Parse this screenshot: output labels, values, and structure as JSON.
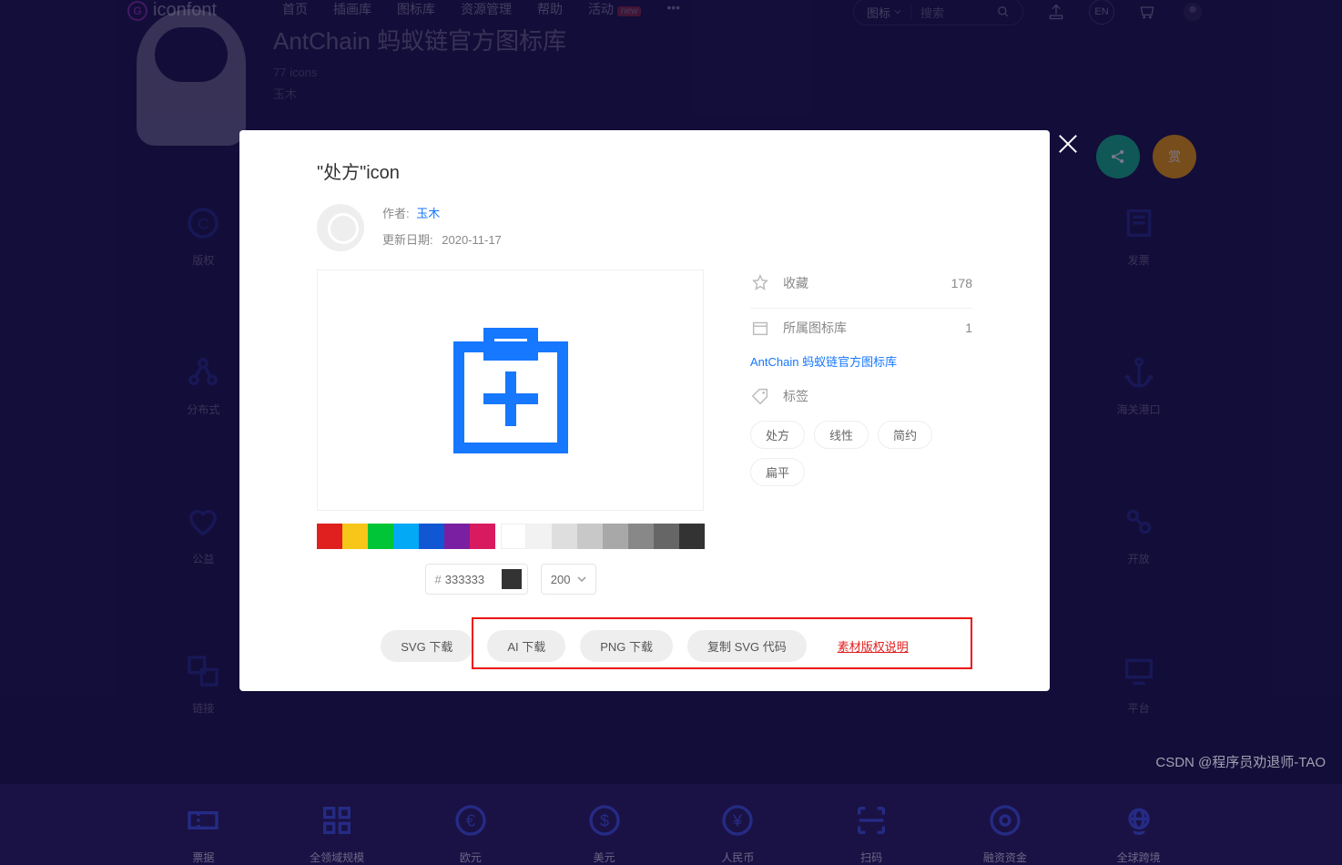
{
  "header": {
    "logo_text": "iconfont",
    "nav": [
      "首页",
      "插画库",
      "图标库",
      "资源管理",
      "帮助",
      "活动"
    ],
    "nav_badge": "new",
    "search_scope": "图标",
    "search_placeholder": "搜索"
  },
  "library": {
    "title": "AntChain 蚂蚁链官方图标库",
    "count": "77 icons",
    "owner": "玉木"
  },
  "fab": {
    "share": "分享",
    "reward": "赏"
  },
  "bg_categories": [
    {
      "label": "版权"
    },
    {
      "label": "—"
    },
    {
      "label": "—"
    },
    {
      "label": "—"
    },
    {
      "label": "—"
    },
    {
      "label": "—"
    },
    {
      "label": "—"
    },
    {
      "label": "发票"
    },
    {
      "label": "分布式"
    },
    {
      "label": "—"
    },
    {
      "label": "—"
    },
    {
      "label": "—"
    },
    {
      "label": "—"
    },
    {
      "label": "—"
    },
    {
      "label": "—"
    },
    {
      "label": "海关港口"
    },
    {
      "label": "公益"
    },
    {
      "label": "—"
    },
    {
      "label": "—"
    },
    {
      "label": "—"
    },
    {
      "label": "—"
    },
    {
      "label": "—"
    },
    {
      "label": "—"
    },
    {
      "label": "开放"
    },
    {
      "label": "链接"
    },
    {
      "label": "—"
    },
    {
      "label": "—"
    },
    {
      "label": "—"
    },
    {
      "label": "—"
    },
    {
      "label": "—"
    },
    {
      "label": "—"
    },
    {
      "label": "平台"
    },
    {
      "label": "票据"
    },
    {
      "label": "全领域规模"
    },
    {
      "label": "欧元"
    },
    {
      "label": "美元"
    },
    {
      "label": "人民币"
    },
    {
      "label": "扫码"
    },
    {
      "label": "融资资金"
    },
    {
      "label": "全球跨境"
    }
  ],
  "modal": {
    "title": "\"处方\"icon",
    "author_label": "作者:",
    "author_name": "玉木",
    "update_label": "更新日期:",
    "update_date": "2020-11-17",
    "fav_label": "收藏",
    "fav_count": "178",
    "lib_label": "所属图标库",
    "lib_count": "1",
    "lib_link": "AntChain 蚂蚁链官方图标库",
    "tag_label": "标签",
    "tags": [
      "处方",
      "线性",
      "简约",
      "扁平"
    ],
    "palette": [
      "#e01f1f",
      "#f6c618",
      "#00c637",
      "#03a9f4",
      "#1156d2",
      "#7b1fa2",
      "#d81b60",
      "#ffffff",
      "#f2f2f2",
      "#dedede",
      "#c8c8c8",
      "#a8a8a8",
      "#888888",
      "#666666",
      "#333333"
    ],
    "hex_value": "333333",
    "size_value": "200",
    "buttons": {
      "svg": "SVG 下载",
      "ai": "AI 下载",
      "png": "PNG 下载",
      "copy": "复制 SVG 代码"
    },
    "copyright": "素材版权说明"
  },
  "watermark": "CSDN @程序员劝退师-TAO"
}
